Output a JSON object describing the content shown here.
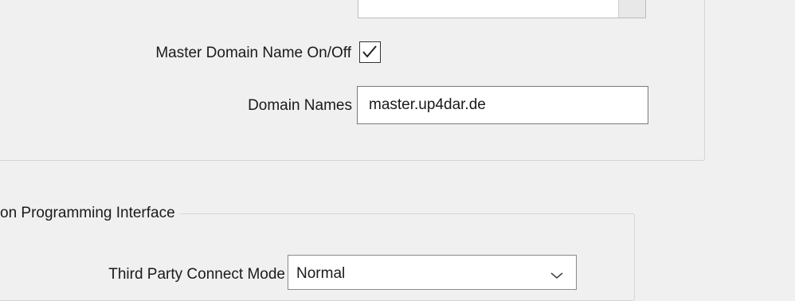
{
  "dns_group": {
    "master_domain_label": "Master Domain Name On/Off",
    "master_domain_checked": true,
    "domain_names_label": "Domain Names",
    "domain_names_value": "master.up4dar.de"
  },
  "api_group": {
    "title": "on Programming Interface",
    "third_party_label": "Third Party Connect Mode",
    "third_party_value": "Normal"
  },
  "icons": {
    "checkbox": "checkmark-icon",
    "dropdown": "chevron-down-icon"
  }
}
